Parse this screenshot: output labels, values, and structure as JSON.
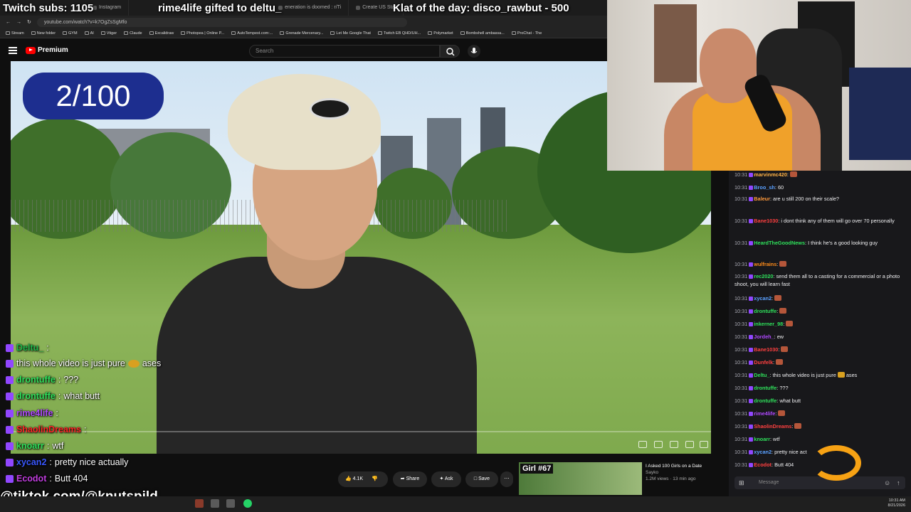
{
  "browser": {
    "tabs": [
      "Instagram",
      "eneration is doomed : r/Ti",
      "Create US Stat"
    ],
    "url": "youtube.com/watch?v=k7OgZsSgMfo",
    "bookmarks": [
      "Stream",
      "New folder",
      "GYM",
      "AI",
      "Vtiger",
      "Claude",
      "Excalidraw",
      "Photopea | Online P...",
      "AutoTempest.com:...",
      "Grenade Mercenary...",
      "Let Me Google That",
      "Twitch EB QHD/UH...",
      "Polymarket",
      "Bombshell ambassa...",
      "ProChat - The"
    ]
  },
  "overlay": {
    "subs": "Twitch subs: 1105",
    "gift": "rime4life gifted to deltu_",
    "klat": "Klat of the day: disco_rawbut - 500",
    "tiktok": "@tiktok.com/@knutspild"
  },
  "youtube": {
    "premium_label": "Premium",
    "search_placeholder": "Search",
    "counter": "2/100",
    "likes": "4.1K",
    "share": "Share",
    "ask": "Ask",
    "save": "Save",
    "rec_tag": "Girl #67",
    "rec_title": "I Asked 100 Girls on a Date",
    "rec_channel": "Sayko",
    "rec_meta": "1.2M views · 13 min ago"
  },
  "overlay_chat": [
    {
      "user": "Deltu_",
      "text": "",
      "color": "#1fb84a"
    },
    {
      "user": "",
      "text": "this whole video is just pure",
      "suffix": "ases",
      "color": "#ffffff"
    },
    {
      "user": "drontuffe",
      "text": "???",
      "color": "#2fe05b"
    },
    {
      "user": "drontuffe",
      "text": "what butt",
      "color": "#2fe05b"
    },
    {
      "user": "rime4life",
      "text": "",
      "color": "#b048ff"
    },
    {
      "user": "ShaolinDreams",
      "text": "",
      "color": "#ff2525"
    },
    {
      "user": "knoarr",
      "text": "wtf",
      "color": "#2fe05b"
    },
    {
      "user": "xycan2",
      "text": "pretty nice actually",
      "color": "#3a58ff"
    },
    {
      "user": "Ecodot",
      "text": "Butt 404",
      "color": "#c23ee0"
    }
  ],
  "chat": {
    "messages": [
      {
        "time": "10:31",
        "user": "marvinmc420",
        "text": "",
        "color": "#ffb347"
      },
      {
        "time": "10:31",
        "user": "Broo_sh",
        "text": "60",
        "color": "#5aa0ff"
      },
      {
        "time": "10:31",
        "user": "Baleur",
        "text": "are u still 200 on their scale?",
        "color": "#ff9a3c"
      },
      {
        "time": "10:31",
        "user": "Bane1030",
        "text": "i dont think any of them will go over 70 personally",
        "color": "#ff4040"
      },
      {
        "time": "10:31",
        "user": "HeardTheGoodNews",
        "text": "I think he's a good looking guy",
        "color": "#2fe05b"
      },
      {
        "time": "10:31",
        "user": "wulfrains",
        "text": "",
        "color": "#ff8c1a"
      },
      {
        "time": "10:31",
        "user": "rec2020",
        "text": "send them all to a casting for a commercial or a photo shoot, you will learn fast",
        "color": "#2fe05b"
      },
      {
        "time": "10:31",
        "user": "xycan2",
        "text": "",
        "color": "#5aa0ff"
      },
      {
        "time": "10:31",
        "user": "drontuffe",
        "text": "",
        "color": "#2fe05b"
      },
      {
        "time": "10:31",
        "user": "inkerner_98",
        "text": "",
        "color": "#2fe05b"
      },
      {
        "time": "10:31",
        "user": "Jordeh_",
        "text": "ew",
        "color": "#b048ff"
      },
      {
        "time": "10:31",
        "user": "Bane1030",
        "text": "",
        "color": "#ff4040"
      },
      {
        "time": "10:31",
        "user": "Dunfelk",
        "text": "",
        "color": "#ff4040"
      },
      {
        "time": "10:31",
        "user": "Deltu_",
        "text": "this whole video is just pure",
        "suffix": "ases",
        "color": "#2fe05b"
      },
      {
        "time": "10:31",
        "user": "drontuffe",
        "text": "???",
        "color": "#2fe05b"
      },
      {
        "time": "10:31",
        "user": "drontuffe",
        "text": "what butt",
        "color": "#2fe05b"
      },
      {
        "time": "10:31",
        "user": "rime4life",
        "text": "",
        "color": "#b048ff"
      },
      {
        "time": "10:31",
        "user": "ShaolinDreams",
        "text": "",
        "color": "#ff4040"
      },
      {
        "time": "10:31",
        "user": "knoarr",
        "text": "wtf",
        "color": "#2fe05b"
      },
      {
        "time": "10:31",
        "user": "xycan2",
        "text": "pretty nice act",
        "color": "#5aa0ff"
      },
      {
        "time": "10:31",
        "user": "Ecodot",
        "text": "Butt 404",
        "color": "#ff4040"
      }
    ],
    "input_placeholder": "Message"
  },
  "taskbar": {
    "time": "10:31 AM",
    "date": "8/21/2026"
  }
}
